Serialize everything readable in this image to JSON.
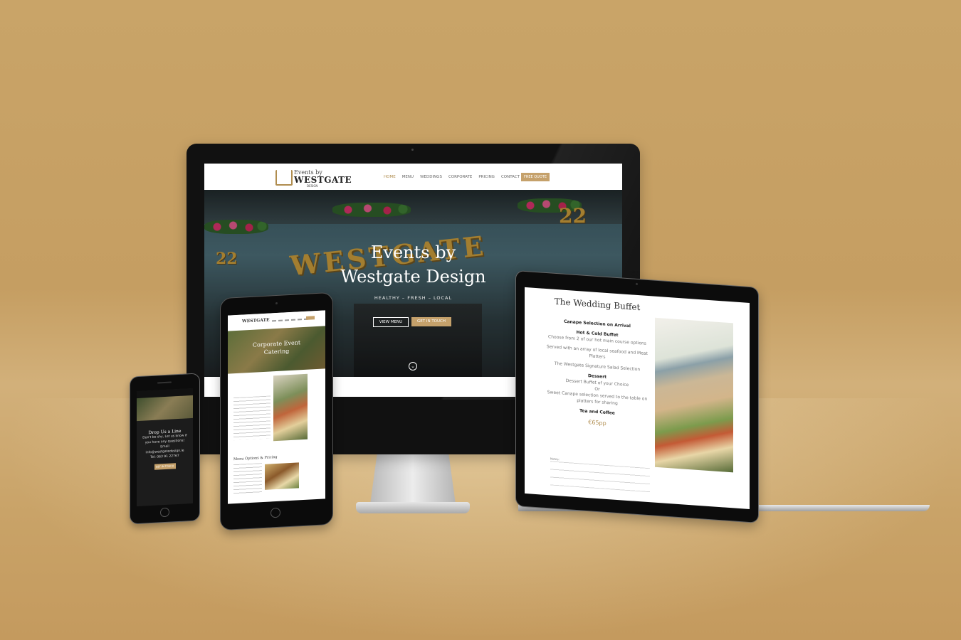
{
  "site": {
    "logo": {
      "line1": "Events by",
      "line2": "WESTGATE",
      "line3": "DESIGN"
    },
    "nav": [
      "HOME",
      "MENU",
      "WEDDINGS",
      "CORPORATE",
      "PRICING",
      "CONTACT"
    ],
    "quote_button": "FREE QUOTE",
    "accent_color": "#c5a16b"
  },
  "desktop": {
    "hero_title_line1": "Events by",
    "hero_title_line2": "Westgate Design",
    "hero_tagline": "HEALTHY – FRESH – LOCAL",
    "button_view_menu": "VIEW MENU",
    "button_get_in_touch": "GET IN TOUCH",
    "storefront_sign": "WESTGATE",
    "storefront_number": "22"
  },
  "tablet": {
    "hero_title_line1": "Corporate Event",
    "hero_title_line2": "Catering",
    "section_heading": "Menu Options & Pricing"
  },
  "phone": {
    "heading": "Drop Us a Line",
    "text_line1": "Don't be shy, Let us know if",
    "text_line2": "you have any questions!",
    "email_label": "Email",
    "email": "info@westgatedesign.ie",
    "phone": "Tel: 063 91 22767",
    "button": "GET IN TOUCH"
  },
  "laptop": {
    "title": "The Wedding Buffet",
    "h1": "Canape Selection on Arrival",
    "h2": "Hot & Cold Buffet",
    "l1": "Choose from 2 of our hot main course options",
    "l2": "Served with an array of local seafood and Meat Platters",
    "l3": "The Westgate Signature Salad Selection",
    "h3": "Dessert",
    "l4": "Dessert Buffet of your Choice",
    "l5": "Or",
    "l6": "Sweet Canape selection served to the table on platters for sharing",
    "h4": "Tea and Coffee",
    "price": "€65pp",
    "notes_label": "Notes:"
  }
}
